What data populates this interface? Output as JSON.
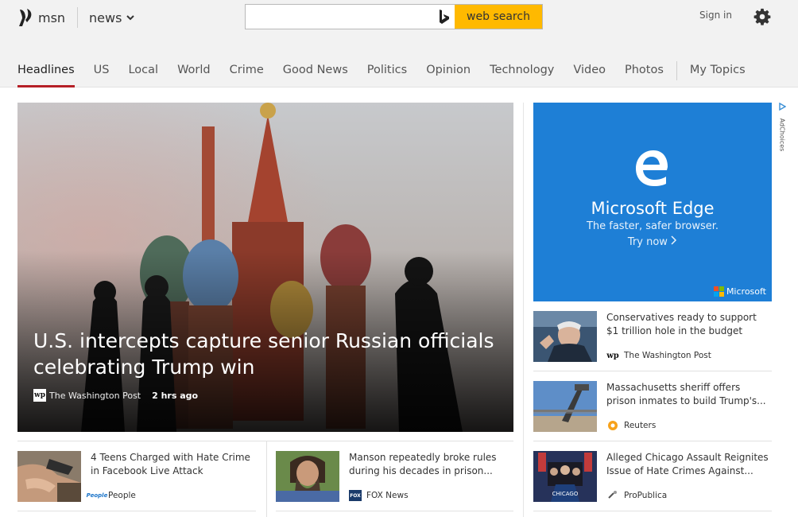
{
  "header": {
    "logo_text": "msn",
    "section_label": "news",
    "search_placeholder": "",
    "search_button": "web search",
    "sign_in": "Sign in"
  },
  "nav": {
    "items": [
      "Headlines",
      "US",
      "Local",
      "World",
      "Crime",
      "Good News",
      "Politics",
      "Opinion",
      "Technology",
      "Video",
      "Photos"
    ],
    "my_topics": "My Topics",
    "active_index": 0
  },
  "hero": {
    "title": "U.S. intercepts capture senior Russian officials celebrating Trump win",
    "source": "The Washington Post",
    "time": "2 hrs ago"
  },
  "ad": {
    "title": "Microsoft Edge",
    "subtitle": "The faster, safer browser.",
    "cta": "Try now",
    "brand": "Microsoft",
    "adchoices": "AdChoices",
    "colors": {
      "background": "#1e7fd6",
      "brand_red": "#f25022",
      "brand_green": "#7fba00",
      "brand_blue": "#00a4ef",
      "brand_yellow": "#ffb900"
    }
  },
  "side_stories": [
    {
      "title": "Conservatives ready to support $1 trillion hole in the budget",
      "source": "The Washington Post",
      "icon": "washington-post-icon"
    },
    {
      "title": "Massachusetts sheriff offers prison inmates to build Trump's...",
      "source": "Reuters",
      "icon": "reuters-icon"
    },
    {
      "title": "Alleged Chicago Assault Reignites Issue of Hate Crimes Against...",
      "source": "ProPublica",
      "icon": "propublica-icon"
    }
  ],
  "bottom_stories": [
    {
      "title": "4 Teens Charged with Hate Crime in Facebook Live Attack",
      "source": "People",
      "icon": "people-icon"
    },
    {
      "title": "Manson repeatedly broke rules during his decades in prison...",
      "source": "FOX News",
      "icon": "fox-news-icon"
    }
  ],
  "colors": {
    "accent": "#b51f26",
    "search_button": "#ffb900"
  }
}
